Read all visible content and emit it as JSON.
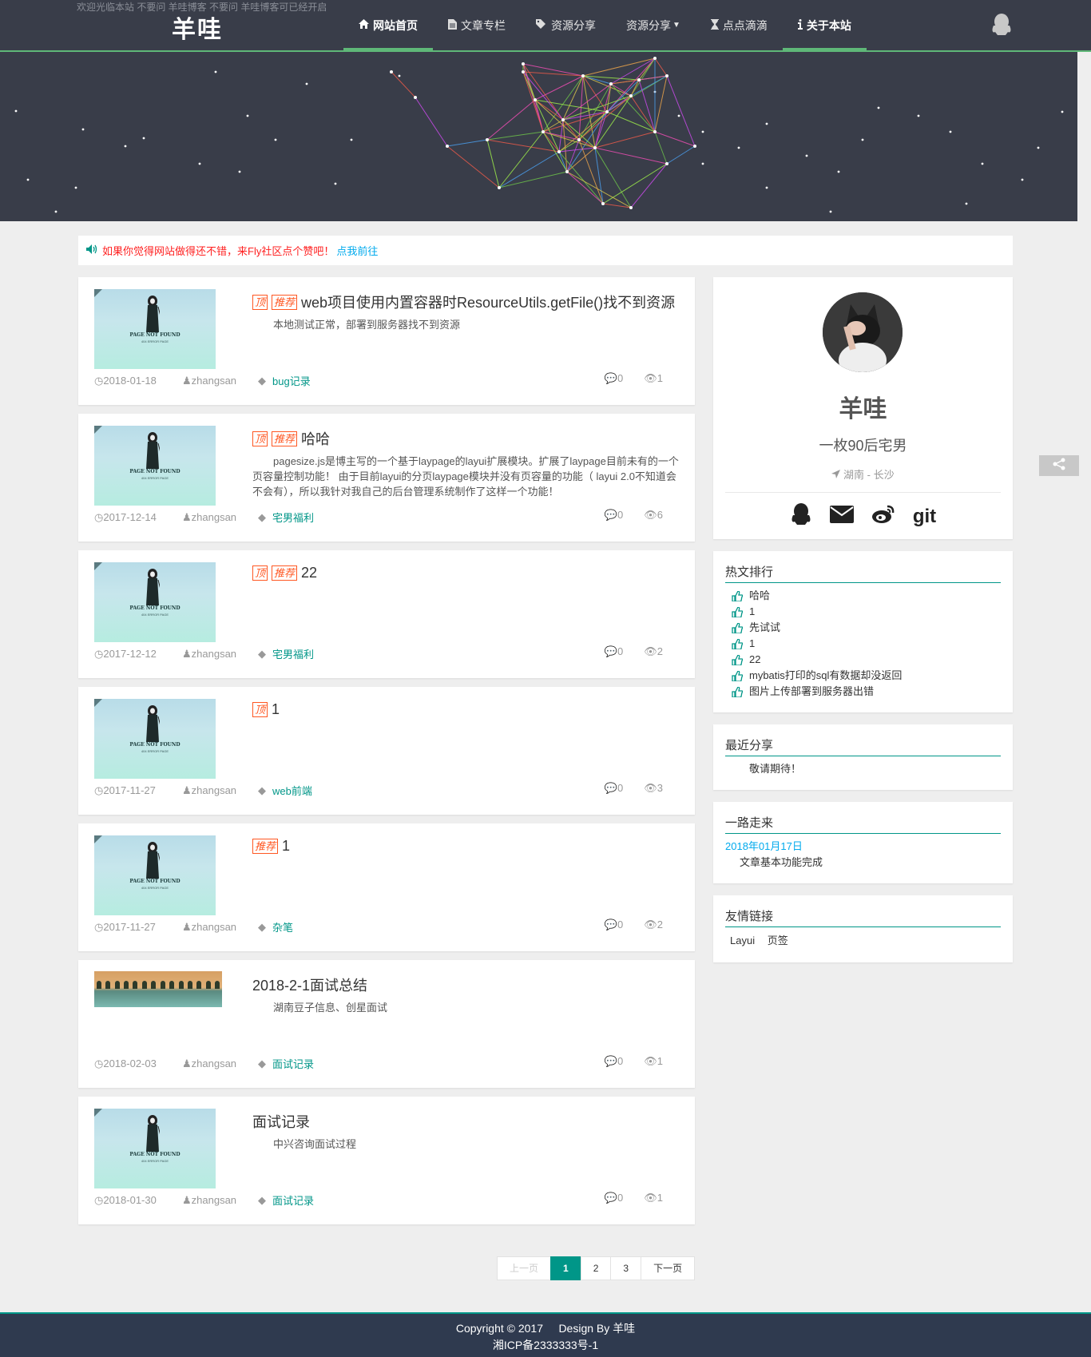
{
  "header": {
    "notice": "欢迎光临本站 不要问 羊哇博客 不要问 羊哇博客可已经开启",
    "logo": "羊哇",
    "nav": [
      {
        "label": "网站首页",
        "icon": "home-icon",
        "active": true
      },
      {
        "label": "文章专栏",
        "icon": "file-icon",
        "active": false
      },
      {
        "label": "资源分享",
        "icon": "tags-icon",
        "active": false
      },
      {
        "label": "资源分享",
        "icon": "",
        "caret": true,
        "active": false
      },
      {
        "label": "点点滴滴",
        "icon": "hourglass-icon",
        "active": false
      },
      {
        "label": "关于本站",
        "icon": "info-icon",
        "active": true
      }
    ],
    "user_icon": "qq-icon"
  },
  "notice": {
    "icon": "volume-icon",
    "text": "如果你觉得网站做得还不错，来Fly社区点个赞吧！",
    "link": "点我前往"
  },
  "articles": [
    {
      "ding": "顶",
      "tuijian": "推荐",
      "title": "web项目使用内置容器时ResourceUtils.getFile()找不到资源",
      "summary": "本地测试正常，部署到服务器找不到资源",
      "date": "2018-01-18",
      "author": "zhangsan",
      "category": "bug记录",
      "comments": "0",
      "views": "1",
      "thumb": "404"
    },
    {
      "ding": "顶",
      "tuijian": "推荐",
      "title": "哈哈",
      "summary": "pagesize.js是博主写的一个基于laypage的layui扩展模块。扩展了laypage目前未有的一个页容量控制功能！ 由于目前layui的分页laypage模块并没有页容量的功能（ layui 2.0不知道会不会有），所以我针对我自己的后台管理系统制作了这样一个功能！",
      "date": "2017-12-14",
      "author": "zhangsan",
      "category": "宅男福利",
      "comments": "0",
      "views": "6",
      "thumb": "404"
    },
    {
      "ding": "顶",
      "tuijian": "推荐",
      "title": "22",
      "summary": "",
      "date": "2017-12-12",
      "author": "zhangsan",
      "category": "宅男福利",
      "comments": "0",
      "views": "2",
      "thumb": "404"
    },
    {
      "ding": "顶",
      "tuijian": "",
      "title": "1",
      "summary": "",
      "date": "2017-11-27",
      "author": "zhangsan",
      "category": "web前端",
      "comments": "0",
      "views": "3",
      "thumb": "404"
    },
    {
      "ding": "",
      "tuijian": "推荐",
      "title": "1",
      "summary": "",
      "date": "2017-11-27",
      "author": "zhangsan",
      "category": "杂笔",
      "comments": "0",
      "views": "2",
      "thumb": "404"
    },
    {
      "ding": "",
      "tuijian": "",
      "title": "2018-2-1面试总结",
      "summary": "湖南豆子信息、创星面试",
      "date": "2018-02-03",
      "author": "zhangsan",
      "category": "面试记录",
      "comments": "0",
      "views": "1",
      "thumb": "landscape"
    },
    {
      "ding": "",
      "tuijian": "",
      "title": "面试记录",
      "summary": "中兴咨询面试过程",
      "date": "2018-01-30",
      "author": "zhangsan",
      "category": "面试记录",
      "comments": "0",
      "views": "1",
      "thumb": "404"
    }
  ],
  "thumb404": {
    "title": "PAGE NOT FOUND",
    "sub": "404 ERROR PAGE"
  },
  "pager": {
    "prev": "上一页",
    "pages": [
      "1",
      "2",
      "3"
    ],
    "current": "1",
    "next": "下一页"
  },
  "profile": {
    "name": "羊哇",
    "desc": "一枚90后宅男",
    "location": "湖南 - 长沙",
    "social": [
      "qq-icon",
      "envelope-icon",
      "weibo-icon",
      "git"
    ]
  },
  "hot": {
    "title": "热文排行",
    "items": [
      "哈哈",
      "1",
      "先试试",
      "1",
      "22",
      "mybatis打印的sql有数据却没返回",
      "图片上传部署到服务器出错"
    ]
  },
  "recent": {
    "title": "最近分享",
    "text": "敬请期待！"
  },
  "timeline": {
    "title": "一路走来",
    "date": "2018年01月17日",
    "text": "文章基本功能完成"
  },
  "links": {
    "title": "友情链接",
    "items": [
      "Layui",
      "页签"
    ]
  },
  "footer": {
    "line1": "Copyright © 2017     Design By 羊哇",
    "line2": "湘ICP备2333333号-1"
  },
  "colors": {
    "header": "#393d49",
    "accent": "#009688",
    "green": "#5fb878",
    "tag": "#ff5722",
    "footer": "#2f3a4f"
  }
}
